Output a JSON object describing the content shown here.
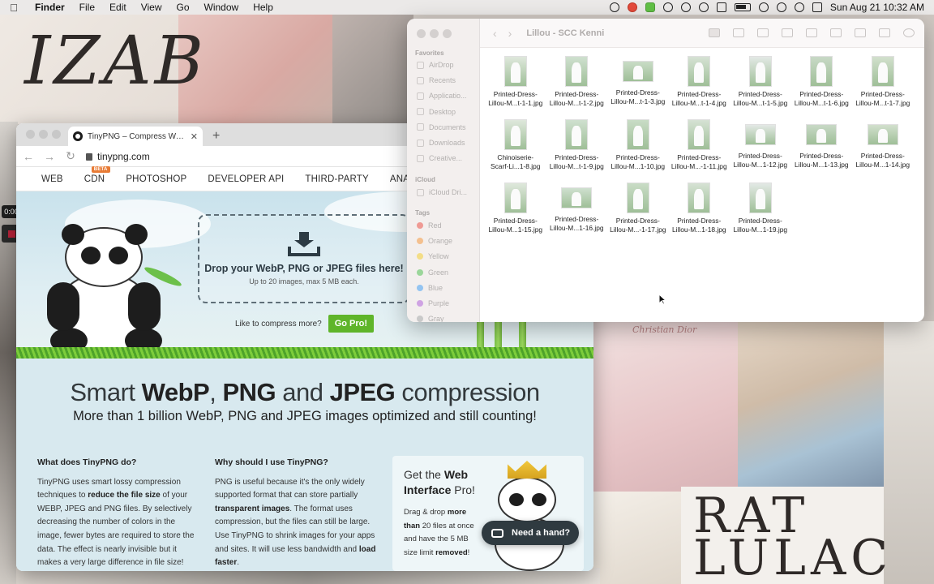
{
  "menubar": {
    "app": "Finder",
    "items": [
      "File",
      "Edit",
      "View",
      "Go",
      "Window",
      "Help"
    ],
    "clock": "Sun Aug 21  10:32 AM"
  },
  "recording": {
    "time": "0:00"
  },
  "browser": {
    "tab_title": "TinyPNG – Compress WebP, PNG",
    "url": "tinypng.com",
    "nav": [
      "WEB",
      "CDN",
      "PHOTOSHOP",
      "DEVELOPER API",
      "THIRD-PARTY",
      "ANALYZER"
    ],
    "beta_badge": "BETA",
    "dropzone": {
      "title": "Drop your WebP, PNG or JPEG files here!",
      "subtitle": "Up to 20 images, max 5 MB each."
    },
    "promo_text": "Like to compress more?",
    "go_pro": "Go Pro!",
    "headline": {
      "pre": "Smart ",
      "b1": "WebP",
      "sep1": ", ",
      "b2": "PNG",
      "sep2": " and ",
      "b3": "JPEG",
      "post": " compression"
    },
    "subline": "More than 1 billion WebP, PNG and JPEG images optimized and still counting!",
    "col1": {
      "title": "What does TinyPNG do?",
      "t1": "TinyPNG uses smart lossy compression techniques to ",
      "b1": "reduce the file size",
      "t2": " of your WEBP, JPEG and PNG files. By selectively decreasing the number of colors in the image, fewer bytes are required to store the data. The effect is nearly invisible but it makes a very large difference in file size!"
    },
    "col2": {
      "title": "Why should I use TinyPNG?",
      "t1": "PNG is useful because it's the only widely supported format that can store partially ",
      "b1": "transparent images",
      "t2": ". The format uses compression, but the files can still be large. Use TinyPNG to shrink images for your apps and sites. It will use less bandwidth and ",
      "b2": "load faster",
      "t3": "."
    },
    "pro_card": {
      "title_pre": "Get the ",
      "title_b": "Web Interface",
      "title_post": " Pro!",
      "t1": "Drag & drop ",
      "b1": "more than",
      "t2": " 20 files at once and have the 5 MB size limit ",
      "b2": "removed",
      "t3": "!"
    },
    "chat_button": "Need a hand?"
  },
  "finder": {
    "title": "Lillou - SCC Kenni",
    "sidebar": {
      "favorites_label": "Favorites",
      "favorites": [
        "AirDrop",
        "Recents",
        "Applicatio...",
        "Desktop",
        "Documents",
        "Downloads",
        "Creative..."
      ],
      "icloud_label": "iCloud",
      "icloud": [
        "iCloud Dri..."
      ],
      "tags_label": "Tags",
      "tags": [
        {
          "name": "Red",
          "color": "#ef9a94"
        },
        {
          "name": "Orange",
          "color": "#f4c08f"
        },
        {
          "name": "Yellow",
          "color": "#f3dd87"
        },
        {
          "name": "Green",
          "color": "#9bd69a"
        },
        {
          "name": "Blue",
          "color": "#94c4f1"
        },
        {
          "name": "Purple",
          "color": "#cfa3e3"
        },
        {
          "name": "Gray",
          "color": "#c9c9c9"
        }
      ]
    },
    "files": [
      {
        "l1": "Printed-Dress-",
        "l2": "Lillou-M...t-1-1.jpg",
        "shape": "portrait"
      },
      {
        "l1": "Printed-Dress-",
        "l2": "Lillou-M...t-1-2.jpg",
        "shape": "portrait"
      },
      {
        "l1": "Printed-Dress-",
        "l2": "Lillou-M...t-1-3.jpg",
        "shape": "landscape"
      },
      {
        "l1": "Printed-Dress-",
        "l2": "Lillou-M...t-1-4.jpg",
        "shape": "portrait"
      },
      {
        "l1": "Printed-Dress-",
        "l2": "Lillou-M...t-1-5.jpg",
        "shape": "portrait"
      },
      {
        "l1": "Printed-Dress-",
        "l2": "Lillou-M...t-1-6.jpg",
        "shape": "portrait"
      },
      {
        "l1": "Printed-Dress-",
        "l2": "Lillou-M...t-1-7.jpg",
        "shape": "portrait"
      },
      {
        "l1": "Chinoiserie-",
        "l2": "Scarf-Li...1-8.jpg",
        "shape": "portrait"
      },
      {
        "l1": "Printed-Dress-",
        "l2": "Lillou-M...t-1-9.jpg",
        "shape": "portrait"
      },
      {
        "l1": "Printed-Dress-",
        "l2": "Lillou-M...1-10.jpg",
        "shape": "portrait"
      },
      {
        "l1": "Printed-Dress-",
        "l2": "Lillou-M...-1-11.jpg",
        "shape": "portrait"
      },
      {
        "l1": "Printed-Dress-",
        "l2": "Lillou-M...1-12.jpg",
        "shape": "landscape"
      },
      {
        "l1": "Printed-Dress-",
        "l2": "Lillou-M...1-13.jpg",
        "shape": "landscape"
      },
      {
        "l1": "Printed-Dress-",
        "l2": "Lillou-M...1-14.jpg",
        "shape": "landscape"
      },
      {
        "l1": "Printed-Dress-",
        "l2": "Lillou-M...1-15.jpg",
        "shape": "portrait"
      },
      {
        "l1": "Printed-Dress-",
        "l2": "Lillou-M...1-16.jpg",
        "shape": "landscape"
      },
      {
        "l1": "Printed-Dress-",
        "l2": "Lillou-M...-1-17.jpg",
        "shape": "portrait"
      },
      {
        "l1": "Printed-Dress-",
        "l2": "Lillou-M...1-18.jpg",
        "shape": "portrait"
      },
      {
        "l1": "Printed-Dress-",
        "l2": "Lillou-M...1-19.jpg",
        "shape": "portrait"
      }
    ]
  },
  "wallpaper": {
    "text_izab": "IZAB",
    "text_rat": "RAT\nLULAC",
    "text_dior": "Christian Dior"
  }
}
